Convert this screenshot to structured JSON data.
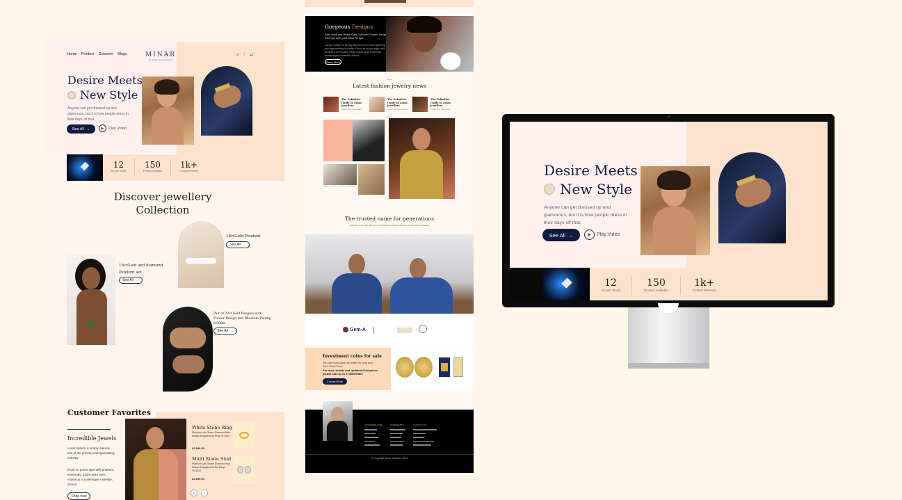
{
  "left": {
    "nav": [
      "Home",
      "Product",
      "Discover",
      "Blogs"
    ],
    "logo": "MINAR",
    "logo_tag": "We deliver desired jewelry",
    "hero_title_1": "Desire Meets",
    "hero_title_2": "New Style",
    "hero_text": "Anyone can get dressed up and glamorous, but it is how people dress in their days off that.",
    "see_all": "See All",
    "play_video": "Play Video",
    "stats": [
      {
        "value": "12",
        "label": "All over World"
      },
      {
        "value": "150",
        "label": "Product Available"
      },
      {
        "value": "1k+",
        "label": "Product Reviews"
      }
    ],
    "discover_title_1": "Discover jewellery",
    "discover_title_2": "Collection",
    "product1": "18ctGold Pendent",
    "product2_1": "18ctGold and diamond",
    "product2_2": "Pendent set",
    "product3_1": "Pair of 22ct Gold Bangles with",
    "product3_2": "Flower Design and Rhodium Plating",
    "product3_3": "8.00dm",
    "see_all_small": "See All",
    "favorites_title": "Customer Favorites",
    "incredible": "Incredible Jewels",
    "incredible_p1": "Lorem Ipsum is simply dummy text of the printing and typesetting industry",
    "incredible_p2": "Proin eu purus eget velit pharetra venenatis. Etiam justo ante, maximus a scelerisque molestie, dictum.",
    "shop_now": "Shop now",
    "ring_title": "White Stone Ring",
    "ring_desc": "Platinum Lab Grown Diamond Halo Design Engagement Ring Ctt.4400",
    "ring_price": "£2,830.00",
    "stud_title": "Multi Stone Stud",
    "stud_desc": "Platinum Lab Grown Diamond Halo Design Engagement Ear Rings Ctt.4400",
    "stud_price": "£2,830.00"
  },
  "mid": {
    "gorgeous_1": "Gorgeous ",
    "gorgeous_2": "Designs",
    "gorgeous_sub": "Best Rate and White Gold Diamond Flower Design Earrings with gold finish 30 tips",
    "gorgeous_text": "Lorem Ipsum is simply dummy text of the printing and typesetting industry. Proin et purus eget velit pharetra venenatis. Etiam justo ante maximus scelerisque molestie dictum.",
    "read_more": "Read More",
    "news_kicker": "BLOG",
    "news_title": "Latest fashion jewelry news",
    "news": [
      {
        "title": "The Definitive Guide to Asian jewellery",
        "meta": "1st Jan 2023 | Remember"
      },
      {
        "title": "The Definitive Guide to Asian jewellery",
        "meta": "1st Jan 2023 | Remember"
      },
      {
        "title": "The Definitive Guide to Asian jewellery",
        "meta": "1st Jan 2023 | Remember"
      }
    ],
    "trusted_title": "The trusted name for generations",
    "trusted_sub": "Discover more offer, discover more than 50 countries discover to have Minar jewellery",
    "gem_a": "Gem-A",
    "coins_title": "Investment coins for sale",
    "coins_text": "You can now place an order for 22kt and 24ct Gold Coins.",
    "coins_text2": "For more details and updated Gold prices please call us on 07495097809",
    "contact_now": "Contact Now",
    "footer_cols": [
      "CUSTOMER CARE",
      "STATEMENTS",
      "CONTACT US"
    ],
    "copyright": "© Copyright Minar Jewellery 2023"
  },
  "monitor": {
    "hero_title_1": "Desire Meets",
    "hero_title_2": "New Style",
    "hero_text": "Anyone can get dressed up and glamorous, but it is how people dress in their days off that.",
    "see_all": "See All",
    "play_video": "Play Video",
    "stats": [
      {
        "value": "12",
        "label": "All over World"
      },
      {
        "value": "150",
        "label": "Product Available"
      },
      {
        "value": "1k+",
        "label": "Product Reviews"
      }
    ]
  }
}
